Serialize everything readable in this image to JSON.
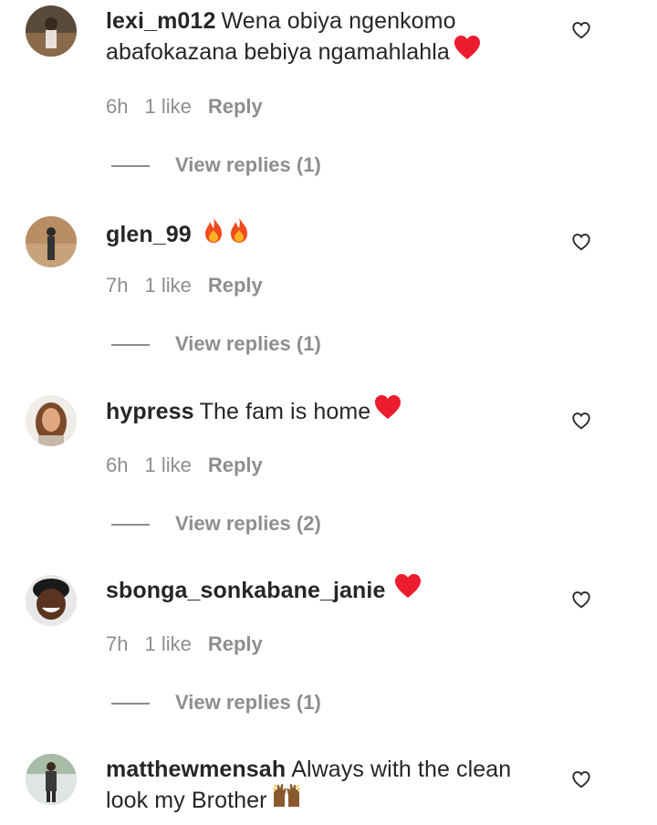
{
  "comments": [
    {
      "username": "lexi_m012",
      "text": "Wena obiya ngenkomo abafokazana bebiya ngamahlahla",
      "time": "6h",
      "likes": "1 like",
      "reply": "Reply",
      "view_replies": "View replies (1)",
      "emoji": "red-heart"
    },
    {
      "username": "glen_99",
      "text": "",
      "time": "7h",
      "likes": "1 like",
      "reply": "Reply",
      "view_replies": "View replies (1)",
      "emoji": "fire-fire"
    },
    {
      "username": "hypress",
      "text": "The fam is home",
      "time": "6h",
      "likes": "1 like",
      "reply": "Reply",
      "view_replies": "View replies (2)",
      "emoji": "red-heart"
    },
    {
      "username": "sbonga_sonkabane_janie",
      "text": "",
      "time": "7h",
      "likes": "1 like",
      "reply": "Reply",
      "view_replies": "View replies (1)",
      "emoji": "red-heart"
    },
    {
      "username": "matthewmensah",
      "text": "Always with the clean look my Brother",
      "emoji": "raising-hands"
    }
  ],
  "colors": {
    "text": "#262626",
    "secondary": "#8e8e8e",
    "heart": "#ed1c2e"
  }
}
